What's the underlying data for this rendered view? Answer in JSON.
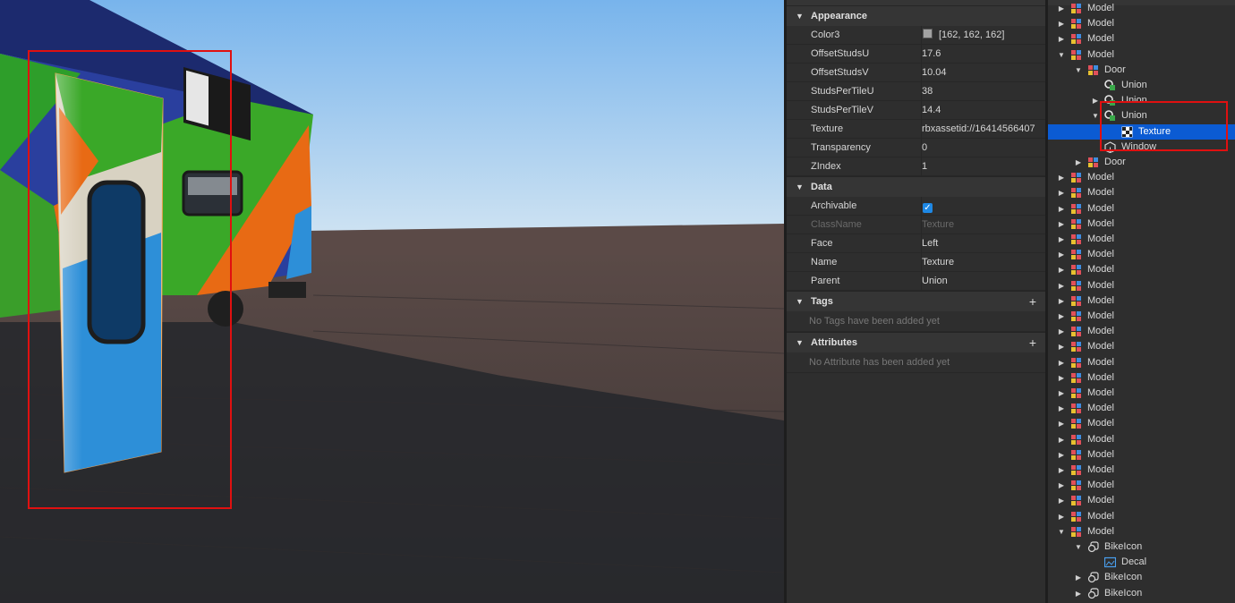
{
  "properties": {
    "sections": [
      {
        "title": "Appearance",
        "rows": [
          {
            "key": "Color3",
            "value": "[162, 162, 162]",
            "swatch": "#a2a2a2"
          },
          {
            "key": "OffsetStudsU",
            "value": "17.6"
          },
          {
            "key": "OffsetStudsV",
            "value": "10.04"
          },
          {
            "key": "StudsPerTileU",
            "value": "38"
          },
          {
            "key": "StudsPerTileV",
            "value": "14.4"
          },
          {
            "key": "Texture",
            "value": "rbxassetid://16414566407"
          },
          {
            "key": "Transparency",
            "value": "0"
          },
          {
            "key": "ZIndex",
            "value": "1"
          }
        ]
      },
      {
        "title": "Data",
        "rows": [
          {
            "key": "Archivable",
            "value": "checked"
          },
          {
            "key": "ClassName",
            "value": "Texture",
            "dim": true
          },
          {
            "key": "Face",
            "value": "Left"
          },
          {
            "key": "Name",
            "value": "Texture"
          },
          {
            "key": "Parent",
            "value": "Union"
          }
        ]
      },
      {
        "title": "Tags",
        "empty": "No Tags have been added yet"
      },
      {
        "title": "Attributes",
        "empty": "No Attribute has been added yet"
      }
    ]
  },
  "explorer": {
    "items": [
      {
        "label": "Model",
        "icon": "model-icon",
        "depth": 1,
        "arrow": "collapsed"
      },
      {
        "label": "Model",
        "icon": "model-icon",
        "depth": 1,
        "arrow": "collapsed"
      },
      {
        "label": "Model",
        "icon": "model-icon",
        "depth": 1,
        "arrow": "collapsed"
      },
      {
        "label": "Model",
        "icon": "model-icon",
        "depth": 1,
        "arrow": "expanded"
      },
      {
        "label": "Door",
        "icon": "model-icon",
        "depth": 2,
        "arrow": "expanded"
      },
      {
        "label": "Union",
        "icon": "union-icon",
        "depth": 3,
        "arrow": "none"
      },
      {
        "label": "Union",
        "icon": "union-icon",
        "depth": 3,
        "arrow": "collapsed"
      },
      {
        "label": "Union",
        "icon": "union-icon",
        "depth": 3,
        "arrow": "expanded"
      },
      {
        "label": "Texture",
        "icon": "texture-icon",
        "depth": 4,
        "arrow": "none",
        "selected": true
      },
      {
        "label": "Window",
        "icon": "part-icon",
        "depth": 3,
        "arrow": "none"
      },
      {
        "label": "Door",
        "icon": "model-icon",
        "depth": 2,
        "arrow": "collapsed"
      },
      {
        "label": "Model",
        "icon": "model-icon",
        "depth": 1,
        "arrow": "collapsed"
      },
      {
        "label": "Model",
        "icon": "model-icon",
        "depth": 1,
        "arrow": "collapsed"
      },
      {
        "label": "Model",
        "icon": "model-icon",
        "depth": 1,
        "arrow": "collapsed"
      },
      {
        "label": "Model",
        "icon": "model-icon",
        "depth": 1,
        "arrow": "collapsed"
      },
      {
        "label": "Model",
        "icon": "model-icon",
        "depth": 1,
        "arrow": "collapsed"
      },
      {
        "label": "Model",
        "icon": "model-icon",
        "depth": 1,
        "arrow": "collapsed"
      },
      {
        "label": "Model",
        "icon": "model-icon",
        "depth": 1,
        "arrow": "collapsed"
      },
      {
        "label": "Model",
        "icon": "model-icon",
        "depth": 1,
        "arrow": "collapsed"
      },
      {
        "label": "Model",
        "icon": "model-icon",
        "depth": 1,
        "arrow": "collapsed"
      },
      {
        "label": "Model",
        "icon": "model-icon",
        "depth": 1,
        "arrow": "collapsed"
      },
      {
        "label": "Model",
        "icon": "model-icon",
        "depth": 1,
        "arrow": "collapsed"
      },
      {
        "label": "Model",
        "icon": "model-icon",
        "depth": 1,
        "arrow": "collapsed"
      },
      {
        "label": "Model",
        "icon": "model-icon",
        "depth": 1,
        "arrow": "collapsed"
      },
      {
        "label": "Model",
        "icon": "model-icon",
        "depth": 1,
        "arrow": "collapsed"
      },
      {
        "label": "Model",
        "icon": "model-icon",
        "depth": 1,
        "arrow": "collapsed"
      },
      {
        "label": "Model",
        "icon": "model-icon",
        "depth": 1,
        "arrow": "collapsed"
      },
      {
        "label": "Model",
        "icon": "model-icon",
        "depth": 1,
        "arrow": "collapsed"
      },
      {
        "label": "Model",
        "icon": "model-icon",
        "depth": 1,
        "arrow": "collapsed"
      },
      {
        "label": "Model",
        "icon": "model-icon",
        "depth": 1,
        "arrow": "collapsed"
      },
      {
        "label": "Model",
        "icon": "model-icon",
        "depth": 1,
        "arrow": "collapsed"
      },
      {
        "label": "Model",
        "icon": "model-icon",
        "depth": 1,
        "arrow": "collapsed"
      },
      {
        "label": "Model",
        "icon": "model-icon",
        "depth": 1,
        "arrow": "collapsed"
      },
      {
        "label": "Model",
        "icon": "model-icon",
        "depth": 1,
        "arrow": "collapsed"
      },
      {
        "label": "Model",
        "icon": "model-icon",
        "depth": 1,
        "arrow": "expanded"
      },
      {
        "label": "BikeIcon",
        "icon": "surface-gui-icon",
        "depth": 2,
        "arrow": "expanded"
      },
      {
        "label": "Decal",
        "icon": "decal-icon",
        "depth": 3,
        "arrow": "none"
      },
      {
        "label": "BikeIcon",
        "icon": "surface-gui-icon",
        "depth": 2,
        "arrow": "collapsed"
      },
      {
        "label": "BikeIcon",
        "icon": "surface-gui-icon",
        "depth": 2,
        "arrow": "collapsed"
      }
    ]
  },
  "colors": {
    "selection": "#0b5bd3",
    "annotation": "#e01010",
    "sky_top": "#7fb9ee",
    "ground": "#4a3f3d"
  }
}
